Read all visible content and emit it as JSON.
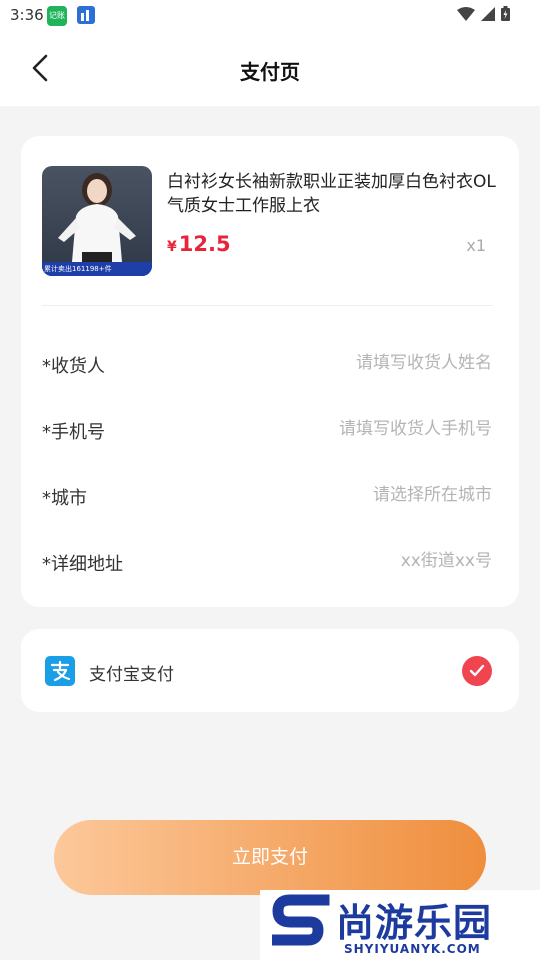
{
  "status": {
    "time": "3:36",
    "app_icon_a_text": "记账"
  },
  "header": {
    "title": "支付页"
  },
  "product": {
    "title": "白衬衫女长袖新款职业正装加厚白色衬衣OL气质女士工作服上衣",
    "currency": "¥",
    "price": "12.5",
    "quantity": "x1",
    "image_banner": "累计卖出161198+件"
  },
  "form": {
    "fields": [
      {
        "label": "*收货人",
        "placeholder": "请填写收货人姓名",
        "value": ""
      },
      {
        "label": "*手机号",
        "placeholder": "请填写收货人手机号",
        "value": ""
      },
      {
        "label": "*城市",
        "placeholder": "请选择所在城市",
        "value": ""
      },
      {
        "label": "*详细地址",
        "placeholder": "xx街道xx号",
        "value": ""
      }
    ]
  },
  "payment": {
    "method_label": "支付宝支付",
    "selected": true
  },
  "actions": {
    "pay_label": "立即支付"
  },
  "watermark": {
    "title": "尚游乐园",
    "domain": "SHYIYUANYK.COM"
  },
  "colors": {
    "price": "#e8233b",
    "check": "#f0454f",
    "alipay": "#1a9fe6",
    "button_start": "#fcc89a",
    "button_end": "#ef8e3d"
  },
  "icons": {
    "back": "back-arrow-icon",
    "alipay": "alipay-icon",
    "check": "check-icon",
    "wifi": "wifi-icon",
    "signal": "signal-icon",
    "battery": "battery-icon"
  }
}
